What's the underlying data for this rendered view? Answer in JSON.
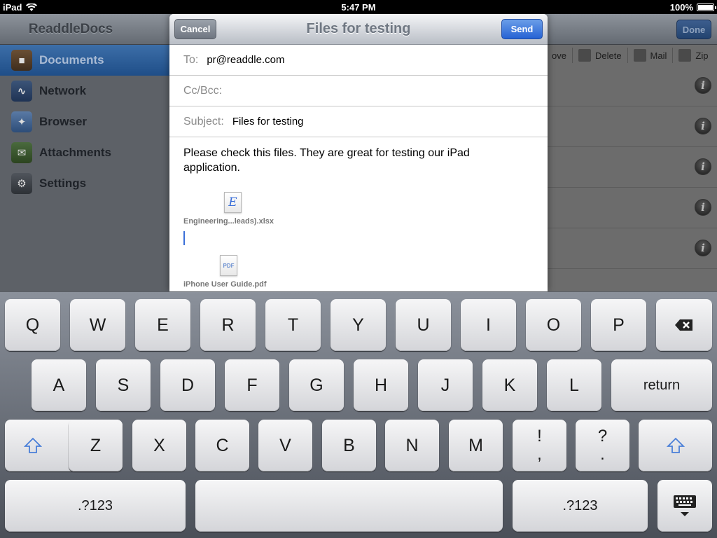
{
  "status_bar": {
    "device": "iPad",
    "time": "5:47 PM",
    "battery": "100%"
  },
  "app": {
    "sidebar_title": "ReaddleDocs",
    "sidebar_items": [
      {
        "label": "Documents",
        "icon": "briefcase-icon",
        "active": true
      },
      {
        "label": "Network",
        "icon": "network-icon",
        "active": false
      },
      {
        "label": "Browser",
        "icon": "compass-icon",
        "active": false
      },
      {
        "label": "Attachments",
        "icon": "envelope-icon",
        "active": false
      },
      {
        "label": "Settings",
        "icon": "gear-icon",
        "active": false
      }
    ],
    "done_label": "Done",
    "toolbar": {
      "move_label": "ove",
      "delete_label": "Delete",
      "mail_label": "Mail",
      "zip_label": "Zip"
    }
  },
  "compose": {
    "title": "Files for testing",
    "cancel_label": "Cancel",
    "send_label": "Send",
    "to_label": "To:",
    "to_value": "pr@readdle.com",
    "cc_label": "Cc/Bcc:",
    "subject_label": "Subject:",
    "subject_value": "Files for testing",
    "body": "Please check this files. They are great for testing our iPad application.",
    "attachments": [
      {
        "name": "Engineering...leads).xlsx",
        "icon_glyph": "E"
      },
      {
        "name": "iPhone User Guide.pdf",
        "icon_glyph": "PDF"
      }
    ]
  },
  "keyboard": {
    "row1": [
      "Q",
      "W",
      "E",
      "R",
      "T",
      "Y",
      "U",
      "I",
      "O",
      "P"
    ],
    "row2": [
      "A",
      "S",
      "D",
      "F",
      "G",
      "H",
      "J",
      "K",
      "L"
    ],
    "return_label": "return",
    "row3": [
      "Z",
      "X",
      "C",
      "V",
      "B",
      "N",
      "M"
    ],
    "excl": [
      "!",
      ","
    ],
    "quest": [
      "?",
      "."
    ],
    "numbers_label": ".?123"
  }
}
